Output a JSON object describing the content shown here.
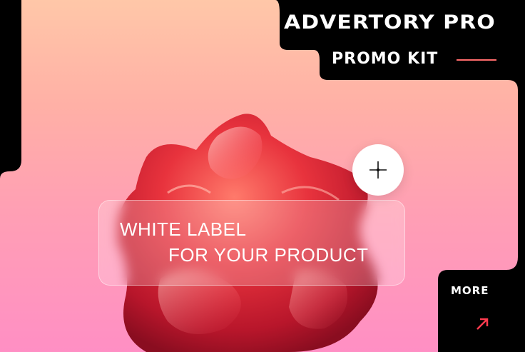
{
  "header": {
    "brand": "ADVERTORY PRO",
    "subtitle": "PROMO KIT"
  },
  "card": {
    "line1": "WHITE LABEL",
    "line2": "FOR YOUR PRODUCT"
  },
  "cta": {
    "label": "MORE"
  },
  "colors": {
    "accent": "#ff6b6b",
    "blob_red": "#e63946",
    "gradient_top": "#ffc7a8",
    "gradient_bottom": "#ff8fc4"
  },
  "icons": {
    "plus": "sparkle-plus-icon",
    "arrow": "arrow-up-right-icon"
  }
}
